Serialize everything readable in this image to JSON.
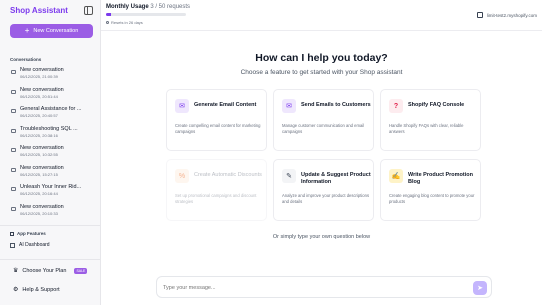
{
  "sidebar": {
    "brand": "Shop Assistant",
    "new_conversation_label": "New Conversation",
    "conversations_heading": "Conversations",
    "conversations": [
      {
        "title": "New conversation",
        "time": "06/12/2025, 21:00:39"
      },
      {
        "title": "New conversation",
        "time": "06/12/2025, 20:51:44"
      },
      {
        "title": "General Assistance for ...",
        "time": "06/12/2025, 20:40:57"
      },
      {
        "title": "Troubleshooting SQL ...",
        "time": "06/12/2025, 20:38:16"
      },
      {
        "title": "New conversation",
        "time": "06/12/2025, 10:32:55"
      },
      {
        "title": "New conversation",
        "time": "06/12/2025, 15:27:15"
      },
      {
        "title": "Unleash Your Inner Rid...",
        "time": "06/12/2025, 20:16:44"
      },
      {
        "title": "New conversation",
        "time": "06/12/2025, 20:10:33"
      }
    ],
    "app_features_heading": "App Features",
    "ai_dashboard_label": "AI Dashboard",
    "choose_plan_label": "Choose Your Plan",
    "sale_badge": "SALE",
    "help_label": "Help & Support"
  },
  "header": {
    "usage_label": "Monthly Usage",
    "usage_count": "3 / 50 requests",
    "usage_fraction": 0.06,
    "resets_text": "Resets in 26 days",
    "store_domain": "limit-test2.myshopify.com"
  },
  "main": {
    "heading": "How can I help you today?",
    "subheading": "Choose a feature to get started with your Shop assistant",
    "cards": [
      {
        "title": "Generate Email Content",
        "desc": "Create compelling email content for marketing campaigns",
        "icon": "email-icon"
      },
      {
        "title": "Send Emails to Customers",
        "desc": "Manage customer communication and email campaigns",
        "icon": "send-icon"
      },
      {
        "title": "Shopify FAQ Console",
        "desc": "Handle Shopify FAQs with clear, reliable answers",
        "icon": "question-icon"
      },
      {
        "title": "Create Automatic Discounts",
        "desc": "Set up promotional campaigns and discount strategies",
        "icon": "discount-icon"
      },
      {
        "title": "Update & Suggest Product Information",
        "desc": "Analyze and improve your product descriptions and details",
        "icon": "edit-icon"
      },
      {
        "title": "Write Product Promotion Blog",
        "desc": "Create engaging blog content to promote your products",
        "icon": "pen-icon"
      }
    ],
    "or_text": "Or simply type your own question below",
    "input_placeholder": "Type your message..."
  },
  "colors": {
    "accent": "#9b5de5",
    "brand_text": "#7c3aed"
  }
}
